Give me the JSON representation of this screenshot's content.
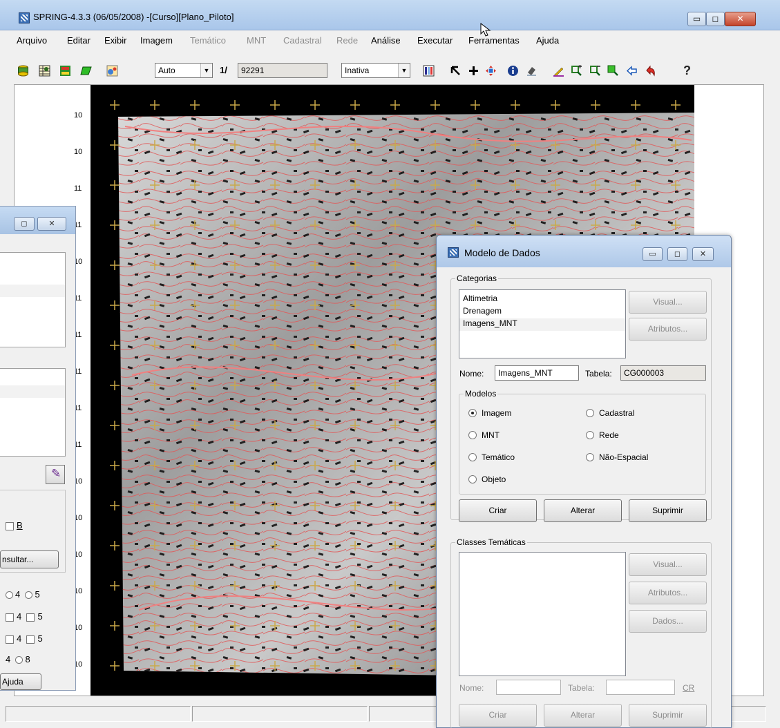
{
  "window": {
    "title": "SPRING-4.3.3 (06/05/2008) -[Curso][Plano_Piloto]",
    "min_glyph": "▭",
    "max_glyph": "◻",
    "close_glyph": "✕"
  },
  "menu": [
    {
      "label": "Arquivo",
      "enabled": true
    },
    {
      "label": "Editar",
      "enabled": true
    },
    {
      "label": "Exibir",
      "enabled": true
    },
    {
      "label": "Imagem",
      "enabled": true
    },
    {
      "label": "Temático",
      "enabled": false
    },
    {
      "label": "MNT",
      "enabled": false
    },
    {
      "label": "Cadastral",
      "enabled": false
    },
    {
      "label": "Rede",
      "enabled": false
    },
    {
      "label": "Análise",
      "enabled": true
    },
    {
      "label": "Executar",
      "enabled": true
    },
    {
      "label": "Ferramentas",
      "enabled": true
    },
    {
      "label": "Ajuda",
      "enabled": true
    }
  ],
  "toolbar": {
    "display_mode": "Auto",
    "zoom_prefix": "1/",
    "scale_value": "92291",
    "state": "Inativa",
    "combo_arrow": "▼",
    "icons": [
      "layers-icon",
      "table-icon",
      "painting-icon",
      "polygon-icon",
      "scale-icon",
      "cursor-icon",
      "plus-icon",
      "pan-icon",
      "info-icon",
      "erase-icon",
      "pencil-icon",
      "zoom-in-icon",
      "zoom-out-icon",
      "zoom-area-icon",
      "back-icon",
      "undo-icon",
      "help-icon"
    ],
    "help_glyph": "?"
  },
  "canvas": {
    "row_labels": [
      "10",
      "10",
      "11",
      "11",
      "10",
      "11",
      "11",
      "11",
      "11",
      "11",
      "10",
      "10",
      "10",
      "10",
      "10",
      "10"
    ],
    "contour_color": "#e05a5a",
    "background": "#000000"
  },
  "left_panel": {
    "pencil_glyph": "✎",
    "check_b_label": "B",
    "consult_label": "nsultar...",
    "radio_row_1": [
      "4",
      "5"
    ],
    "check_row_1": [
      "4",
      "5"
    ],
    "check_row_2": [
      "4",
      "5"
    ],
    "radio_row_2": [
      "4",
      "8"
    ],
    "help_label": "Ajuda"
  },
  "dialog": {
    "title": "Modelo de Dados",
    "categorias_label": "Categorias",
    "categories": [
      "Altimetria",
      "Drenagem",
      "Imagens_MNT"
    ],
    "selected_category": "Imagens_MNT",
    "visual_button": "Visual...",
    "atributos_button": "Atributos...",
    "nome_label": "Nome:",
    "nome_value": "Imagens_MNT",
    "tabela_label": "Tabela:",
    "tabela_value": "CG000003",
    "modelos_label": "Modelos",
    "models": [
      {
        "label": "Imagem",
        "checked": true
      },
      {
        "label": "Cadastral",
        "checked": false
      },
      {
        "label": "MNT",
        "checked": false
      },
      {
        "label": "Rede",
        "checked": false
      },
      {
        "label": "Temático",
        "checked": false
      },
      {
        "label": "Não-Espacial",
        "checked": false
      },
      {
        "label": "Objeto",
        "checked": false
      }
    ],
    "criar_button": "Criar",
    "alterar_button": "Alterar",
    "suprimir_button": "Suprimir",
    "classes_label": "Classes Temáticas",
    "classes_visual": "Visual...",
    "classes_atributos": "Atributos...",
    "classes_dados": "Dados...",
    "classes_nome_label": "Nome:",
    "classes_tabela_label": "Tabela:",
    "classes_cr": "CR",
    "classes_criar": "Criar",
    "classes_alterar": "Alterar",
    "classes_suprimir": "Suprimir"
  }
}
